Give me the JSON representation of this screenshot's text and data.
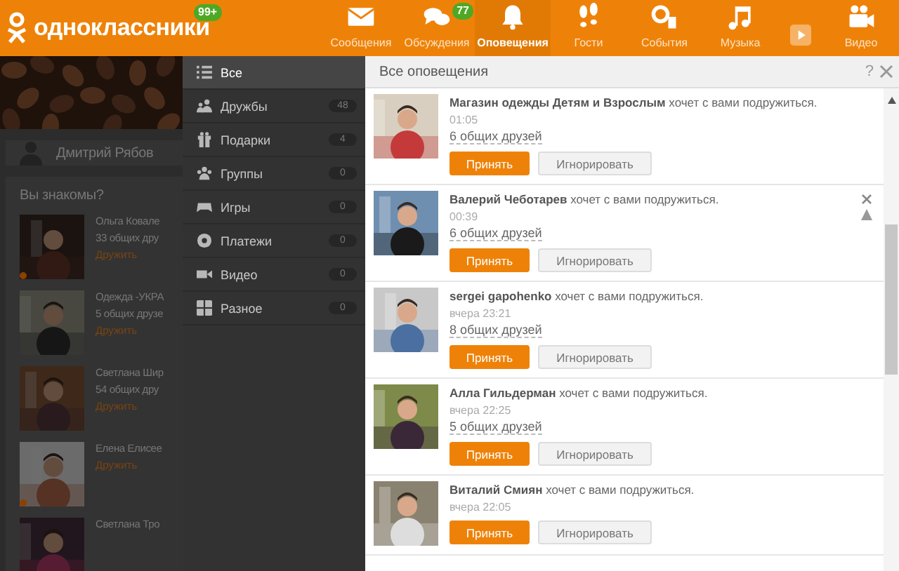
{
  "header": {
    "logo": "одноклассники",
    "logo_badge": "99+",
    "nav": [
      {
        "label": "Сообщения",
        "selected": false
      },
      {
        "label": "Обсуждения",
        "badge": "77",
        "selected": false
      },
      {
        "label": "Оповещения",
        "selected": true
      },
      {
        "label": "Гости",
        "selected": false
      },
      {
        "label": "События",
        "selected": false
      },
      {
        "label": "Музыка",
        "selected": false
      },
      {
        "label": "Видео",
        "selected": false
      }
    ]
  },
  "background_page": {
    "profile_name": "Дмитрий Рябов",
    "suggest_title": "Вы знакомы?",
    "suggestions": [
      {
        "name": "Ольга Ковале",
        "mutual": "33 общих дру",
        "action": "Дружить",
        "online": true
      },
      {
        "name": "Одежда -УКРА",
        "mutual": "5 общих друзе",
        "action": "Дружить",
        "online": false
      },
      {
        "name": "Светлана Шир",
        "mutual": "54 общих дру",
        "action": "Дружить",
        "online": false
      },
      {
        "name": "Елена Елисее",
        "action": "Дружить",
        "online": true
      },
      {
        "name": "Светлана Тро"
      }
    ]
  },
  "sidebar": {
    "items": [
      {
        "label": "Все",
        "selected": true
      },
      {
        "label": "Дружбы",
        "count": "48",
        "selected": false
      },
      {
        "label": "Подарки",
        "count": "4",
        "selected": false
      },
      {
        "label": "Группы",
        "count": "0",
        "selected": false
      },
      {
        "label": "Игры",
        "count": "0",
        "selected": false
      },
      {
        "label": "Платежи",
        "count": "0",
        "selected": false
      },
      {
        "label": "Видео",
        "count": "0",
        "selected": false
      },
      {
        "label": "Разное",
        "count": "0",
        "selected": false
      }
    ]
  },
  "panel": {
    "title": "Все оповещения",
    "help": "?",
    "notifications": [
      {
        "text": "**Магазин одежды Детям и Взрослым** хочет с вами подружиться.",
        "time": "01:05",
        "mutual": "6 общих друзей",
        "accept": "Принять",
        "ignore": "Игнорировать",
        "hovered": false
      },
      {
        "text": "**Валерий Чеботарев** хочет с вами подружиться.",
        "time": "00:39",
        "mutual": "6 общих друзей",
        "accept": "Принять",
        "ignore": "Игнорировать",
        "hovered": true
      },
      {
        "text": "**sergei gapohenko** хочет с вами подружиться.",
        "time": "вчера 23:21",
        "mutual": "8 общих друзей",
        "accept": "Принять",
        "ignore": "Игнорировать",
        "hovered": false
      },
      {
        "text": "**Алла Гильдерман** хочет с вами подружиться.",
        "time": "вчера 22:25",
        "mutual": "5 общих друзей",
        "accept": "Принять",
        "ignore": "Игнорировать",
        "hovered": false
      },
      {
        "text": "**Виталий Смиян** хочет с вами подружиться.",
        "time": "вчера 22:05",
        "accept": "Принять",
        "ignore": "Игнорировать",
        "hovered": false
      }
    ]
  }
}
